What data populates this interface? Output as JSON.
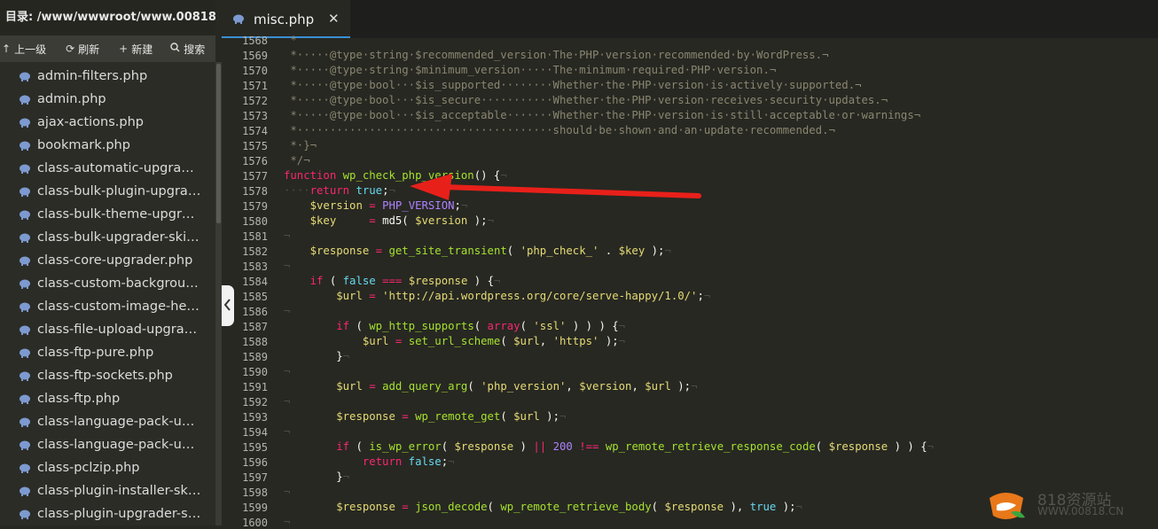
{
  "sidebar": {
    "directory": "目录: /www/wwwroot/www.00818....",
    "toolbar": {
      "up": "上一级",
      "refresh": "刷新",
      "new": "新建",
      "search": "搜索"
    },
    "files": [
      "admin-filters.php",
      "admin.php",
      "ajax-actions.php",
      "bookmark.php",
      "class-automatic-upgrader...",
      "class-bulk-plugin-upgrad...",
      "class-bulk-theme-upgrad...",
      "class-bulk-upgrader-skin....",
      "class-core-upgrader.php",
      "class-custom-background...",
      "class-custom-image-hea...",
      "class-file-upload-upgrade...",
      "class-ftp-pure.php",
      "class-ftp-sockets.php",
      "class-ftp.php",
      "class-language-pack-upg...",
      "class-language-pack-upg...",
      "class-pclzip.php",
      "class-plugin-installer-skin...",
      "class-plugin-upgrader-ski..."
    ]
  },
  "editor": {
    "tab_label": "misc.php",
    "tab_close": "✕",
    "line_numbers": [
      "1568",
      "1569",
      "1570",
      "1571",
      "1572",
      "1573",
      "1574",
      "1575",
      "1576",
      "1577",
      "1578",
      "1579",
      "1580",
      "1581",
      "1582",
      "1583",
      "1584",
      "1585",
      "1586",
      "1587",
      "1588",
      "1589",
      "1590",
      "1591",
      "1592",
      "1593",
      "1594",
      "1595",
      "1596",
      "1597",
      "1598",
      "1599",
      "1600"
    ],
    "lines": [
      " *",
      " *·····@type·string·$recommended_version·The·PHP·version·recommended·by·WordPress.¬",
      " *·····@type·string·$minimum_version·····The·minimum·required·PHP·version.¬",
      " *·····@type·bool···$is_supported········Whether·the·PHP·version·is·actively·supported.¬",
      " *·····@type·bool···$is_secure···········Whether·the·PHP·version·receives·security·updates.¬",
      " *·····@type·bool···$is_acceptable·······Whether·the·PHP·version·is·still·acceptable·or·warnings¬",
      " *·······································should·be·shown·and·an·update·recommended.¬",
      " *·}¬",
      " */¬",
      "function wp_check_php_version() {¬",
      "····return true;¬",
      "    $version = PHP_VERSION;¬",
      "    $key     = md5( $version );¬",
      "¬",
      "    $response = get_site_transient( 'php_check_' . $key );¬",
      "¬",
      "    if ( false === $response ) {¬",
      "        $url = 'http://api.wordpress.org/core/serve-happy/1.0/';¬",
      "¬",
      "        if ( wp_http_supports( array( 'ssl' ) ) ) {¬",
      "            $url = set_url_scheme( $url, 'https' );¬",
      "        }¬",
      "¬",
      "        $url = add_query_arg( 'php_version', $version, $url );¬",
      "¬",
      "        $response = wp_remote_get( $url );¬",
      "¬",
      "        if ( is_wp_error( $response ) || 200 !== wp_remote_retrieve_response_code( $response ) ) {¬",
      "            return false;¬",
      "        }¬",
      "¬",
      "        $response = json_decode( wp_remote_retrieve_body( $response ), true );¬",
      "¬"
    ]
  },
  "watermark": {
    "line1": "818资源站",
    "line2": "WWW.00818.CN"
  },
  "icons": {
    "file": "elephant-php-icon",
    "arrow": "red-annotation-arrow"
  },
  "colors": {
    "accent": "#3a8fd6",
    "arrow": "#e8201a",
    "keyword": "#f92672",
    "function": "#a6e22e",
    "string": "#e6db74",
    "comment": "#8a8670"
  }
}
